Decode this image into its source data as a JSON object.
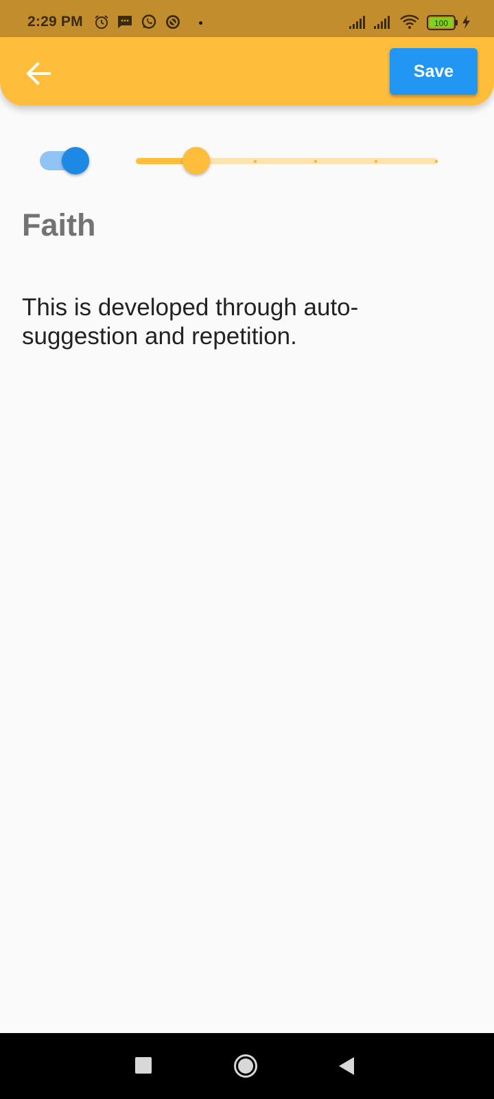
{
  "status_bar": {
    "time": "2:29 PM",
    "icons": [
      "alarm-icon",
      "message-icon",
      "whatsapp-icon",
      "blocked-icon",
      "notification-dot-icon",
      "signal-icon",
      "signal-icon",
      "wifi-icon",
      "battery-icon",
      "charging-icon"
    ],
    "battery_level": "100"
  },
  "app_bar": {
    "back_icon": "arrow-left-icon",
    "save_label": "Save",
    "color": "#ffbd3c"
  },
  "controls": {
    "toggle_on": true,
    "slider_value": 0.2,
    "slider_divisions": 5
  },
  "content": {
    "title": "Faith",
    "description": "This is developed through auto-suggestion and repetition."
  },
  "nav_bar": {
    "icons": [
      "recent-apps-icon",
      "home-icon",
      "back-icon"
    ]
  },
  "colors": {
    "accent": "#ffbd3c",
    "primary_blue": "#2196f3",
    "status_bar": "#c18d2d"
  }
}
